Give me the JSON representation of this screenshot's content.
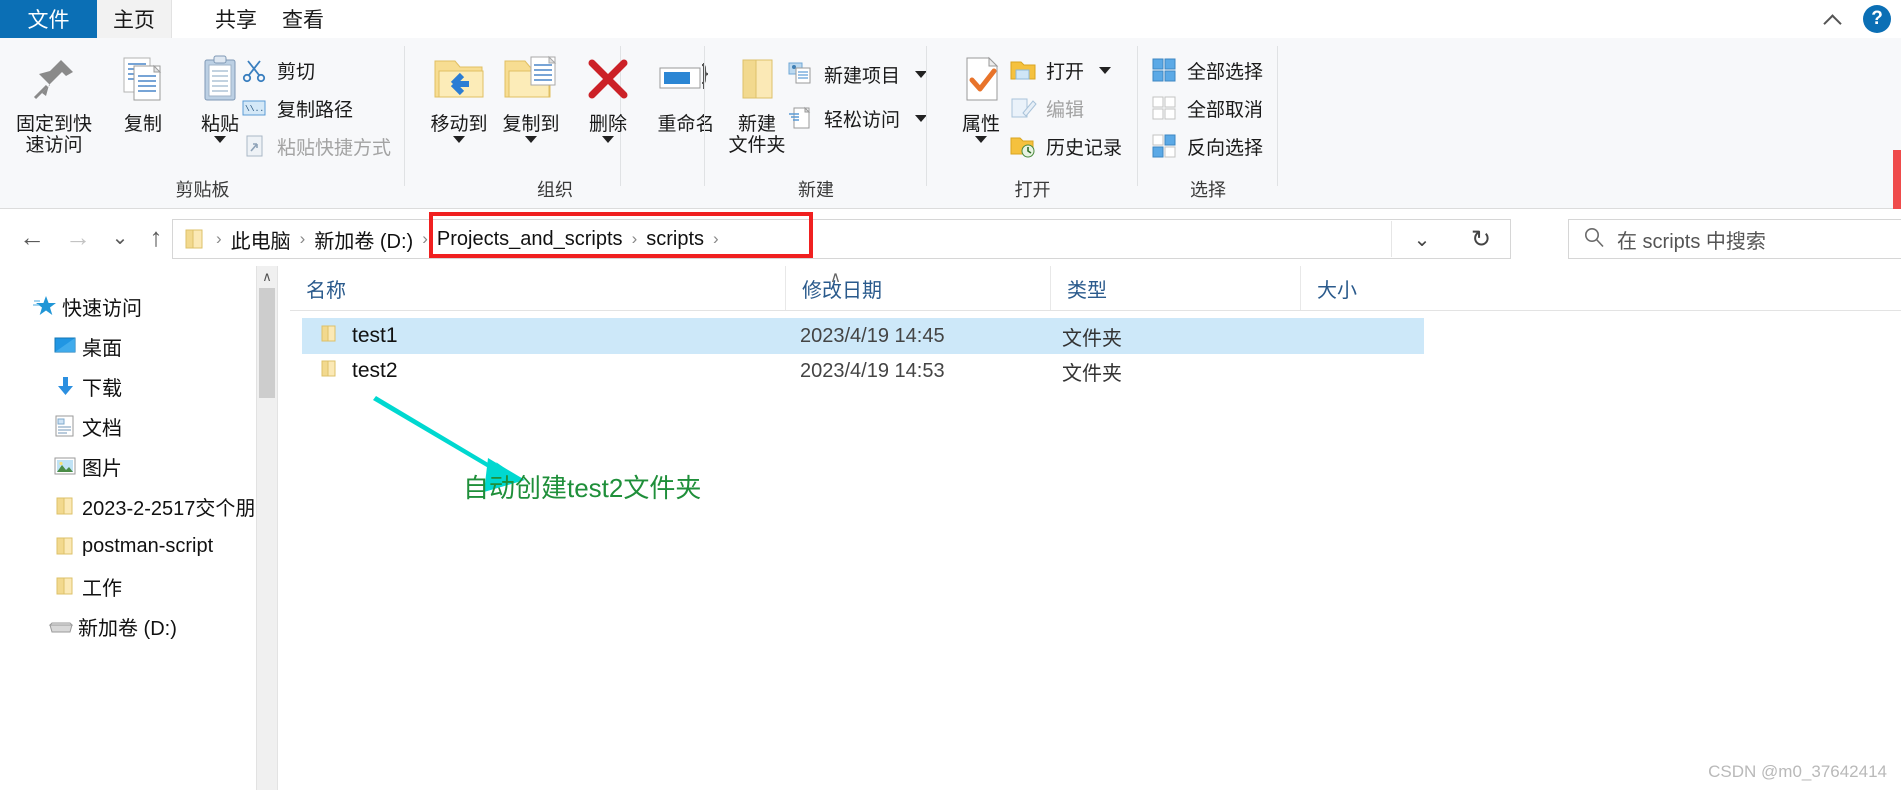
{
  "window": {
    "tabs": [
      {
        "id": "file",
        "label": "文件"
      },
      {
        "id": "home",
        "label": "主页"
      },
      {
        "id": "share",
        "label": "共享"
      },
      {
        "id": "view",
        "label": "查看"
      }
    ],
    "accent_blue": "#0b6fb5",
    "help_label": "?"
  },
  "ribbon": {
    "groups": [
      {
        "name": "clipboard",
        "label": "剪贴板"
      },
      {
        "name": "organize",
        "label": "组织"
      },
      {
        "name": "new",
        "label": "新建"
      },
      {
        "name": "open",
        "label": "打开"
      },
      {
        "name": "select",
        "label": "选择"
      }
    ],
    "clipboard": {
      "pin_to_quick_access": "固定到快\n速访问",
      "pin_line1": "固定到快",
      "pin_line2": "速访问",
      "copy": "复制",
      "paste": "粘贴",
      "cut": "剪切",
      "copy_path": "复制路径",
      "paste_shortcut": "粘贴快捷方式"
    },
    "organize": {
      "move_to": "移动到",
      "copy_to": "复制到",
      "delete": "删除",
      "rename": "重命名"
    },
    "new": {
      "new_folder_line1": "新建",
      "new_folder_line2": "文件夹",
      "new_item": "新建项目",
      "easy_access": "轻松访问"
    },
    "open": {
      "properties": "属性",
      "open": "打开",
      "edit": "编辑",
      "history": "历史记录"
    },
    "select": {
      "select_all": "全部选择",
      "select_none": "全部取消",
      "invert_selection": "反向选择"
    }
  },
  "addressbar": {
    "back": "←",
    "forward": "→",
    "recent": "⌄",
    "up": "↑",
    "crumbs": [
      "此电脑",
      "新加卷 (D:)",
      "Projects_and_scripts",
      "scripts"
    ],
    "separator": "›",
    "dropdown": "⌄",
    "refresh": "↻",
    "highlight_color": "#f02020",
    "highlighted_crumbs": [
      "Projects_and_scripts",
      "scripts"
    ]
  },
  "search": {
    "placeholder": "在 scripts 中搜索",
    "icon": "search-icon"
  },
  "sidebar": {
    "items": [
      {
        "label": "快速访问",
        "icon": "star-icon",
        "pinned": false,
        "indent": 0
      },
      {
        "label": "桌面",
        "icon": "desktop-icon",
        "pinned": true,
        "indent": 1
      },
      {
        "label": "下载",
        "icon": "download-icon",
        "pinned": true,
        "indent": 1
      },
      {
        "label": "文档",
        "icon": "document-icon",
        "pinned": true,
        "indent": 1
      },
      {
        "label": "图片",
        "icon": "pictures-icon",
        "pinned": true,
        "indent": 1
      },
      {
        "label": "2023-2-2517交个朋",
        "icon": "folder-icon",
        "pinned": false,
        "indent": 1
      },
      {
        "label": "postman-script",
        "icon": "folder-icon",
        "pinned": false,
        "indent": 1
      },
      {
        "label": "工作",
        "icon": "folder-icon",
        "pinned": false,
        "indent": 1
      },
      {
        "label": "新加卷 (D:)",
        "icon": "drive-icon",
        "pinned": false,
        "indent": 1
      }
    ],
    "pin_glyph": "📌"
  },
  "filelist": {
    "columns": [
      {
        "key": "name",
        "label": "名称"
      },
      {
        "key": "modified",
        "label": "修改日期"
      },
      {
        "key": "type",
        "label": "类型"
      },
      {
        "key": "size",
        "label": "大小"
      }
    ],
    "sort_indicator": "∧",
    "rows": [
      {
        "name": "test1",
        "modified": "2023/4/19 14:45",
        "type": "文件夹",
        "size": "",
        "selected": true
      },
      {
        "name": "test2",
        "modified": "2023/4/19 14:53",
        "type": "文件夹",
        "size": "",
        "selected": false
      }
    ]
  },
  "annotation": {
    "text": "自动创建test2文件夹",
    "text_color": "#1f8f3a",
    "arrow_color": "#00d8d0"
  },
  "watermark": {
    "text": "CSDN @m0_37642414"
  }
}
